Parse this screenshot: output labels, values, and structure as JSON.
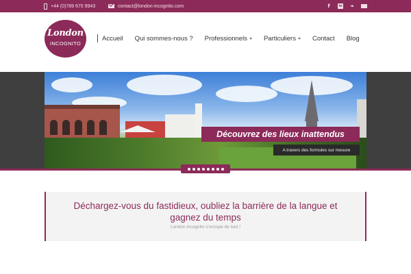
{
  "topbar": {
    "phone": "+44 (0)789 670 9943",
    "email": "contact@london-incognito.com",
    "phone_icon": "phone-icon",
    "email_icon": "envelope-icon",
    "socials": [
      "facebook-icon",
      "linkedin-icon",
      "twitter-icon",
      "mail-icon"
    ],
    "facebook_glyph": "f",
    "linkedin_glyph": "in",
    "twitter_glyph": "❧"
  },
  "logo": {
    "line1": "London",
    "line2": "INCOGNITO"
  },
  "nav": {
    "items": [
      {
        "label": "Accueil",
        "dropdown": false
      },
      {
        "label": "Qui sommes-nous ?",
        "dropdown": false
      },
      {
        "label": "Professionnels",
        "dropdown": true
      },
      {
        "label": "Particuliers",
        "dropdown": true
      },
      {
        "label": "Contact",
        "dropdown": false
      },
      {
        "label": "Blog",
        "dropdown": false
      }
    ]
  },
  "slider": {
    "caption_title": "Découvrez des lieux inattendus",
    "caption_sub": "A travers des formules sur mesure",
    "dot_count": 8,
    "active_dot": 1
  },
  "callout": {
    "headline": "Déchargez-vous du fastidieux, oubliez la barrière de la langue et gagnez du temps",
    "sub": "London incognito s'occupe de tout !"
  },
  "colors": {
    "brand": "#8c2a59",
    "slider_band": "#3f3f3f",
    "caption_dark": "#2a2a2a",
    "callout_bg": "#f3f3f3"
  }
}
